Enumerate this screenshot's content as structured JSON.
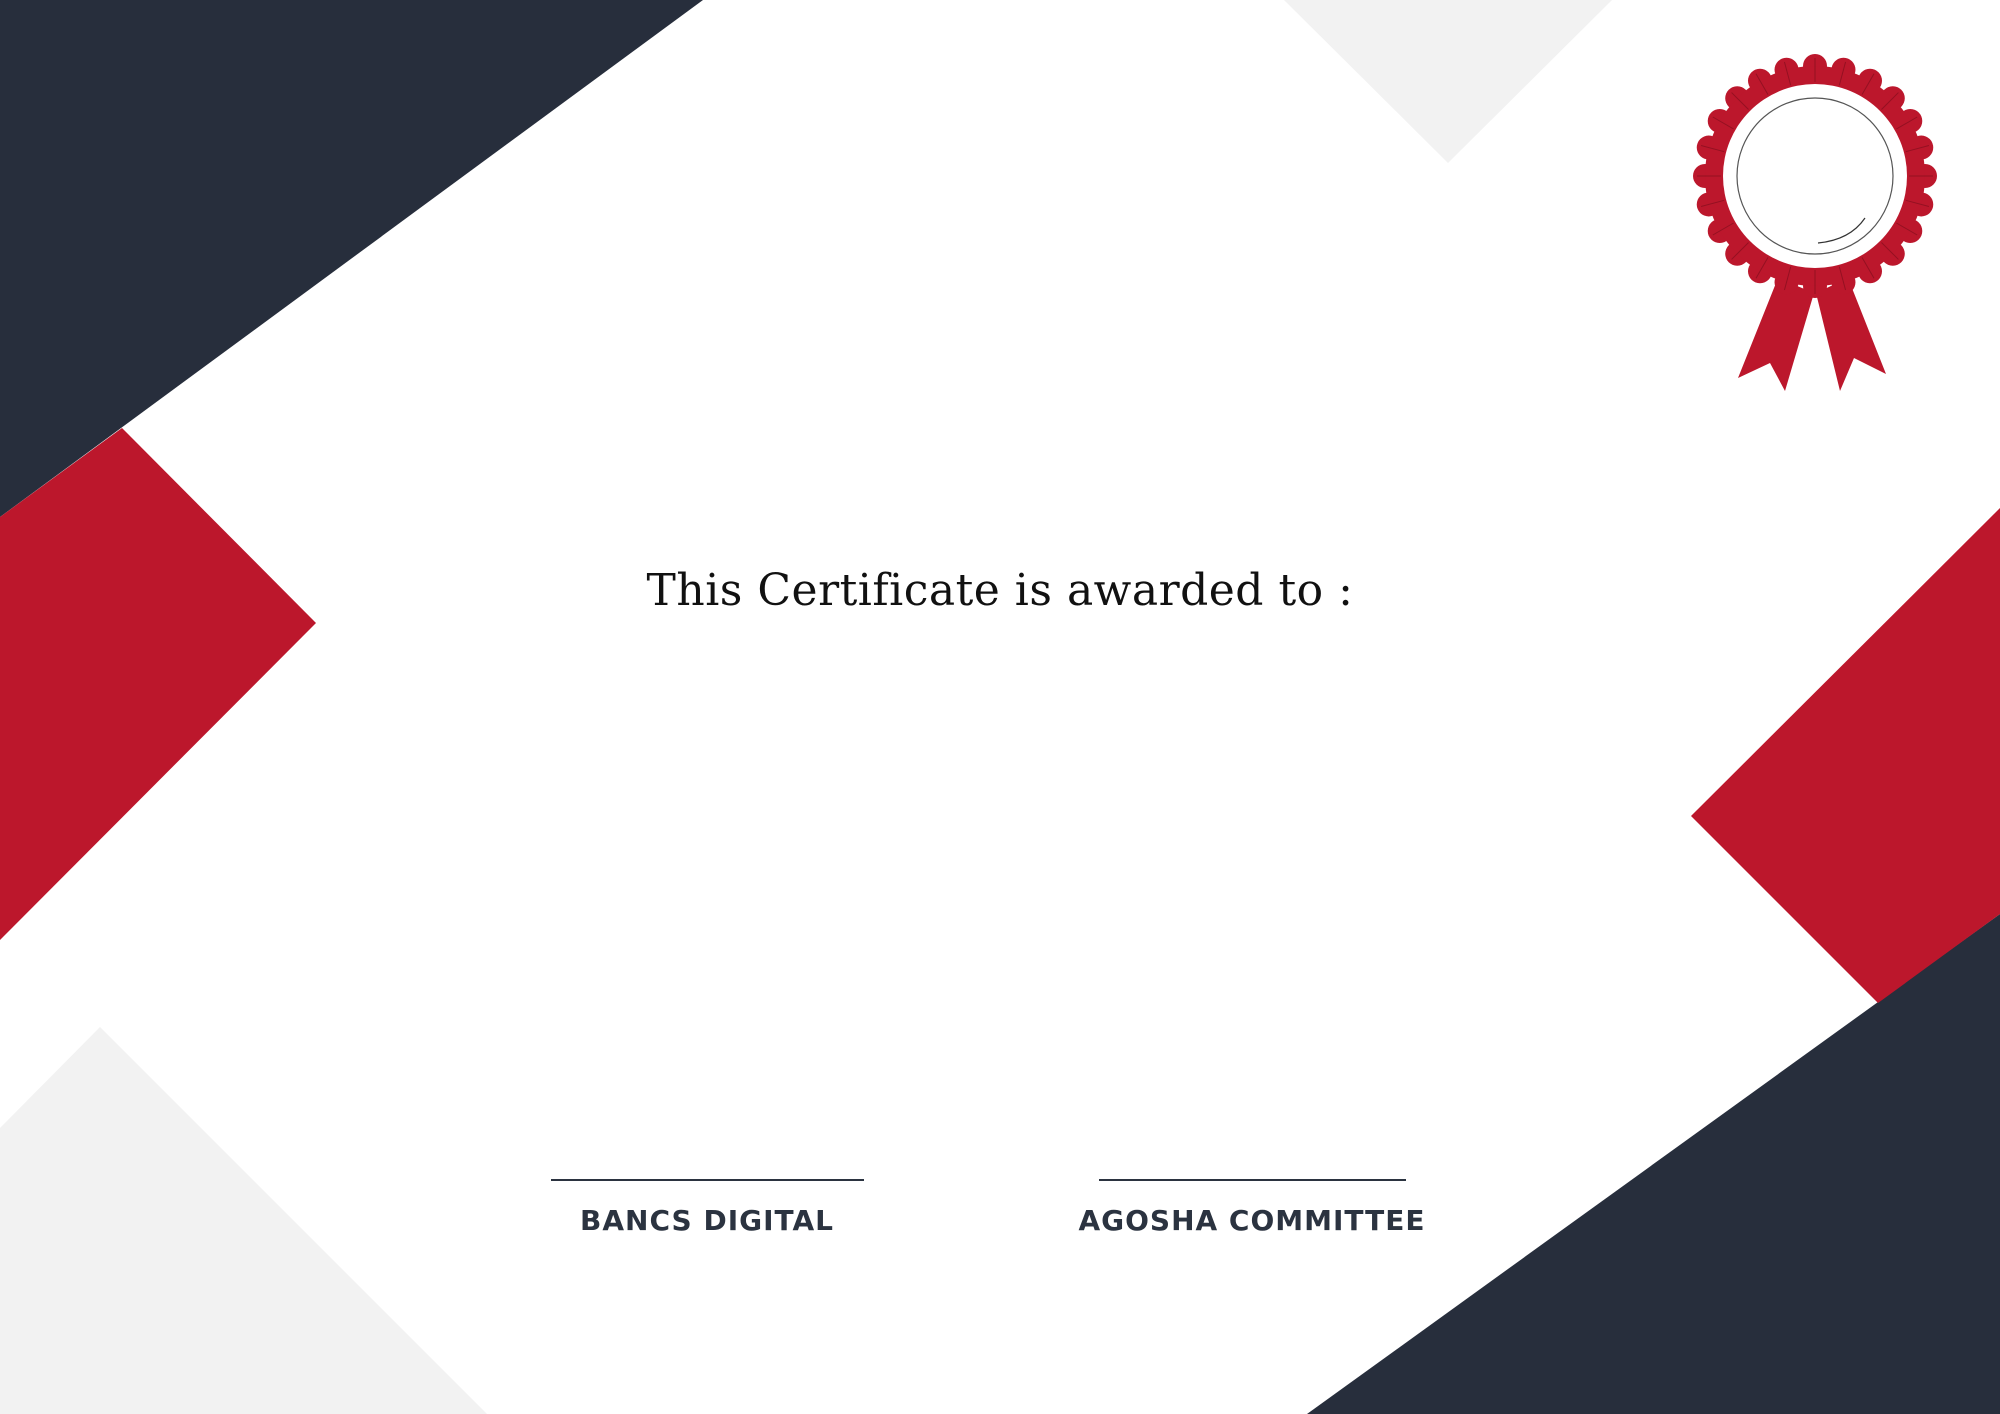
{
  "certificate": {
    "award_text": "This Certificate is awarded to :",
    "signatures": [
      {
        "label": "BANCS DIGITAL"
      },
      {
        "label": "AGOSHA COMMITTEE"
      }
    ]
  },
  "colors": {
    "navy": "#272e3c",
    "red": "#bc172c",
    "light_gray": "#f2f2f2",
    "white": "#ffffff",
    "text_dark": "#111111",
    "label_color": "#2b3340"
  },
  "icons": {
    "seal": "award-rosette-icon"
  }
}
